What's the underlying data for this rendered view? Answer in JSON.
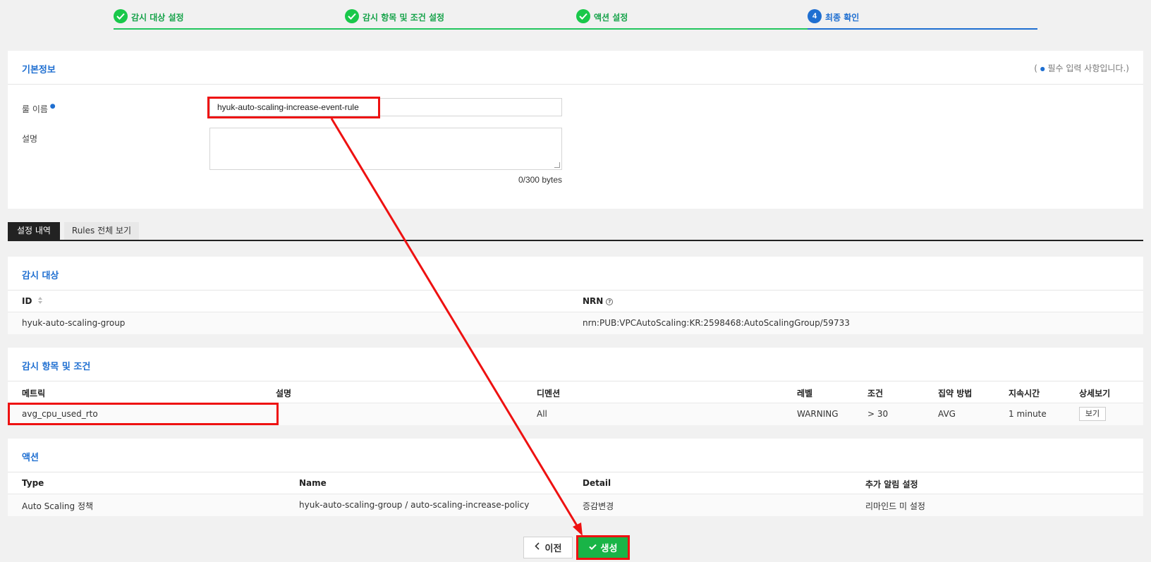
{
  "stepper": {
    "steps": [
      {
        "label": "감시 대상 설정",
        "status": "done"
      },
      {
        "label": "감시 항목 및 조건 설정",
        "status": "done"
      },
      {
        "label": "액션 설정",
        "status": "done"
      },
      {
        "number": "4",
        "label": "최종 확인",
        "status": "active"
      }
    ]
  },
  "basic_info": {
    "title": "기본정보",
    "required_note_prefix": "( ",
    "required_note_suffix": " 필수 입력 사항입니다.)",
    "rule_name_label": "룰 이름",
    "rule_name_value": "hyuk-auto-scaling-increase-event-rule",
    "description_label": "설명",
    "description_value": "",
    "byte_count": "0/300 bytes"
  },
  "tabs": {
    "selected": "설정 내역",
    "other": "Rules 전체 보기"
  },
  "target_section": {
    "title": "감시 대상",
    "headers": {
      "id": "ID",
      "nrn": "NRN"
    },
    "row": {
      "id": "hyuk-auto-scaling-group",
      "nrn": "nrn:PUB:VPCAutoScaling:KR:2598468:AutoScalingGroup/59733"
    }
  },
  "metric_section": {
    "title": "감시 항목 및 조건",
    "headers": {
      "metric": "메트릭",
      "description": "설명",
      "dimension": "디멘션",
      "level": "레벨",
      "condition": "조건",
      "aggregation": "집약 방법",
      "duration": "지속시간",
      "detail": "상세보기"
    },
    "row": {
      "metric": "avg_cpu_used_rto",
      "description": "",
      "dimension": "All",
      "level": "WARNING",
      "condition": "> 30",
      "aggregation": "AVG",
      "duration": "1 minute",
      "detail_button": "보기"
    }
  },
  "action_section": {
    "title": "액션",
    "headers": {
      "type": "Type",
      "name": "Name",
      "detail": "Detail",
      "notification": "추가 알림 설정"
    },
    "row": {
      "type": "Auto Scaling 정책",
      "name": "hyuk-auto-scaling-group / auto-scaling-increase-policy",
      "detail": "증감변경",
      "notification": "리마인드 미 설정"
    }
  },
  "buttons": {
    "prev": "이전",
    "create": "생성"
  },
  "colors": {
    "done_green": "#19c84a",
    "active_blue": "#1f6fd1",
    "create_green": "#19b447",
    "annotation_red": "#ee1111"
  },
  "icons": [
    "check-icon",
    "sort-icon",
    "help-circle-icon",
    "chevron-left-icon"
  ]
}
